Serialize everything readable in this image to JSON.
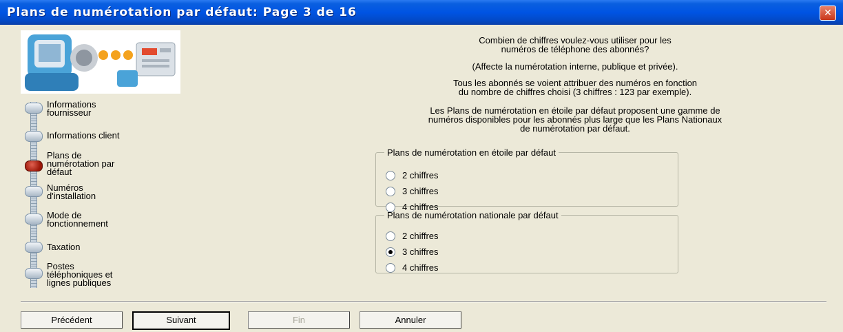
{
  "window": {
    "title": "Plans de numérotation par défaut: Page 3 de 16",
    "close_icon": "close-icon"
  },
  "wizard": {
    "graphic_icon": "phone-wizard-graphic",
    "steps": [
      {
        "label_lines": [
          "Informations",
          "fournisseur"
        ],
        "active": false
      },
      {
        "label_lines": [
          "Informations client"
        ],
        "active": false
      },
      {
        "label_lines": [
          "Plans de",
          "numérotation par",
          "défaut"
        ],
        "active": true
      },
      {
        "label_lines": [
          "Numéros",
          "d'installation"
        ],
        "active": false
      },
      {
        "label_lines": [
          "Mode de",
          "fonctionnement"
        ],
        "active": false
      },
      {
        "label_lines": [
          "Taxation"
        ],
        "active": false
      },
      {
        "label_lines": [
          "Postes",
          "téléphoniques et",
          "lignes publiques"
        ],
        "active": false
      }
    ]
  },
  "content": {
    "question_line1": "Combien de chiffres voulez-vous utiliser pour les",
    "question_line2": "numéros de téléphone des abonnés?",
    "affects": "(Affecte la numérotation interne, publique et privée).",
    "info_line1": "Tous les abonnés se voient attribuer des numéros en fonction",
    "info_line2": "du nombre de chiffres choisi (3 chiffres : 123 par exemple).",
    "star_line1": "Les Plans de numérotation en étoile par défaut proposent une gamme de",
    "star_line2": "numéros disponibles pour les abonnés plus large que les Plans Nationaux",
    "star_line3": "de numérotation par défaut."
  },
  "star_plan": {
    "legend": "Plans de numérotation en étoile par défaut",
    "options": [
      "2 chiffres",
      "3 chiffres",
      "4 chiffres"
    ],
    "selected": null
  },
  "national_plan": {
    "legend": "Plans de numérotation nationale par défaut",
    "options": [
      "2 chiffres",
      "3 chiffres",
      "4 chiffres"
    ],
    "selected": "3 chiffres"
  },
  "buttons": {
    "previous": "Précédent",
    "next": "Suivant",
    "finish": "Fin",
    "cancel": "Annuler"
  }
}
